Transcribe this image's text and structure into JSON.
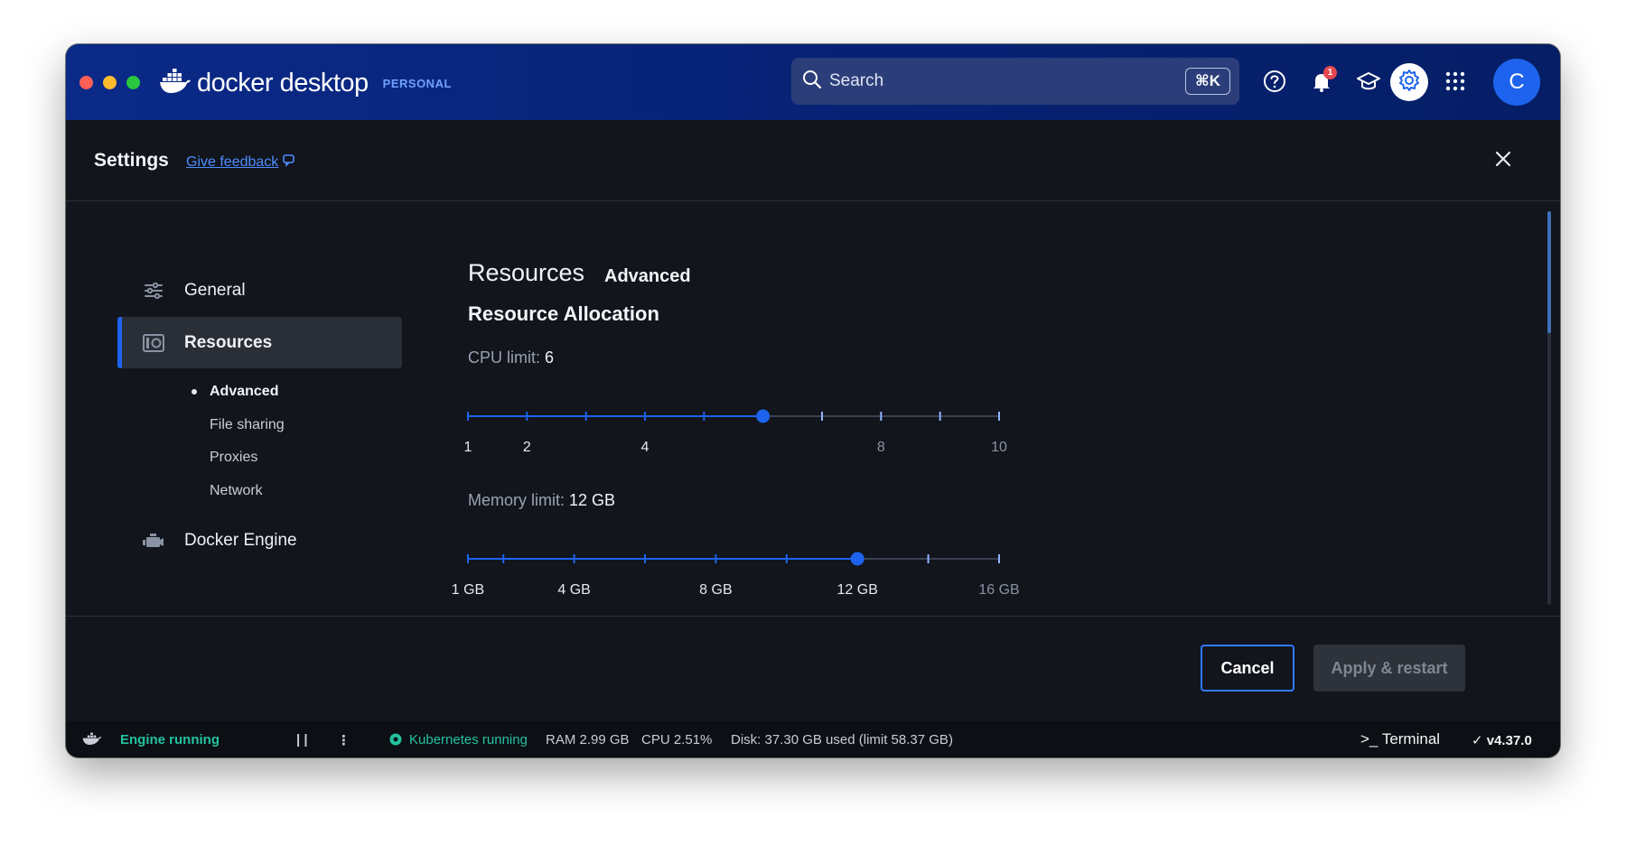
{
  "titlebar": {
    "brand": "docker desktop",
    "plan": "PERSONAL",
    "search_placeholder": "Search",
    "search_shortcut": "⌘K",
    "notification_count": "1",
    "avatar_initial": "C"
  },
  "settings": {
    "title": "Settings",
    "feedback_link": "Give feedback"
  },
  "sidebar": {
    "items": [
      {
        "label": "General",
        "icon": "sliders-icon"
      },
      {
        "label": "Resources",
        "icon": "resources-icon",
        "active": true
      },
      {
        "label": "Docker Engine",
        "icon": "engine-icon"
      }
    ],
    "subitems": [
      {
        "label": "Advanced",
        "current": true
      },
      {
        "label": "File sharing"
      },
      {
        "label": "Proxies"
      },
      {
        "label": "Network"
      }
    ]
  },
  "main": {
    "title": "Resources",
    "tab": "Advanced",
    "section_title": "Resource Allocation",
    "cpu": {
      "label": "CPU limit:",
      "value": "6",
      "min": 1,
      "max": 10,
      "current": 6,
      "tick_labels": [
        "1",
        "2",
        "4",
        "8",
        "10"
      ],
      "tick_values": [
        1,
        2,
        4,
        8,
        10
      ]
    },
    "memory": {
      "label": "Memory limit:",
      "value": "12 GB",
      "min": 1,
      "max": 16,
      "current": 12,
      "tick_labels": [
        "1 GB",
        "4 GB",
        "8 GB",
        "12 GB",
        "16 GB"
      ],
      "tick_values": [
        1,
        4,
        8,
        12,
        16
      ]
    }
  },
  "footer": {
    "cancel": "Cancel",
    "apply": "Apply & restart"
  },
  "statusbar": {
    "engine": "Engine running",
    "pause": "| |",
    "more": "⋮",
    "kubernetes": "Kubernetes running",
    "ram": "RAM 2.99 GB",
    "cpu": "CPU 2.51%",
    "disk": "Disk: 37.30 GB used (limit 58.37 GB)",
    "terminal": "Terminal",
    "version": "v4.37.0"
  },
  "colors": {
    "accent": "#1d63ed",
    "titlebar": "#0b2a88",
    "background": "#12151c",
    "status_green": "#25c2a0"
  }
}
